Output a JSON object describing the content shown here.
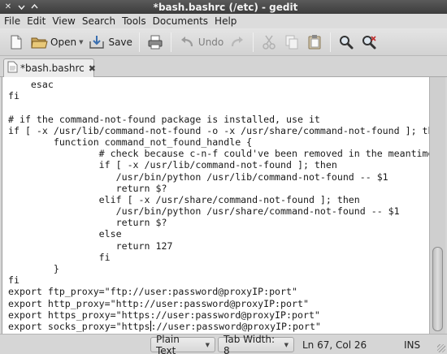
{
  "window": {
    "title": "*bash.bashrc (/etc) - gedit",
    "buttons": [
      "close",
      "minimize",
      "maximize"
    ]
  },
  "menubar": {
    "items": [
      "File",
      "Edit",
      "View",
      "Search",
      "Tools",
      "Documents",
      "Help"
    ]
  },
  "toolbar": {
    "new_icon": "new-document-icon",
    "open_label": "Open",
    "save_label": "Save",
    "print_icon": "printer-icon",
    "undo_label": "Undo",
    "redo_icon": "redo-icon",
    "cut_icon": "cut-icon",
    "copy_icon": "copy-icon",
    "paste_icon": "paste-icon",
    "find_icon": "search-icon",
    "replace_icon": "find-replace-icon"
  },
  "tab": {
    "label": "*bash.bashrc",
    "icon": "text-document-icon"
  },
  "editor": {
    "lines": [
      "    esac",
      "fi",
      "",
      "# if the command-not-found package is installed, use it",
      "if [ -x /usr/lib/command-not-found -o -x /usr/share/command-not-found ]; then",
      "        function command_not_found_handle {",
      "                # check because c-n-f could've been removed in the meantime",
      "                if [ -x /usr/lib/command-not-found ]; then",
      "                   /usr/bin/python /usr/lib/command-not-found -- $1",
      "                   return $?",
      "                elif [ -x /usr/share/command-not-found ]; then",
      "                   /usr/bin/python /usr/share/command-not-found -- $1",
      "                   return $?",
      "                else",
      "                   return 127",
      "                fi",
      "        }",
      "fi",
      "export ftp_proxy=\"ftp://user:password@proxyIP:port\"",
      "export http_proxy=\"http://user:password@proxyIP:port\"",
      "export https_proxy=\"https://user:password@proxyIP:port\"",
      "export socks_proxy=\"https://user:password@proxyIP:port\""
    ],
    "cursor_line": 22,
    "cursor_col": 26
  },
  "statusbar": {
    "language": "Plain Text",
    "tab_width": "Tab Width: 8",
    "position": "Ln 67, Col 26",
    "mode": "INS"
  },
  "colors": {
    "titlebar": "#4a4a4a",
    "editor_bg": "#ffffff",
    "chrome": "#d6d6d6"
  }
}
